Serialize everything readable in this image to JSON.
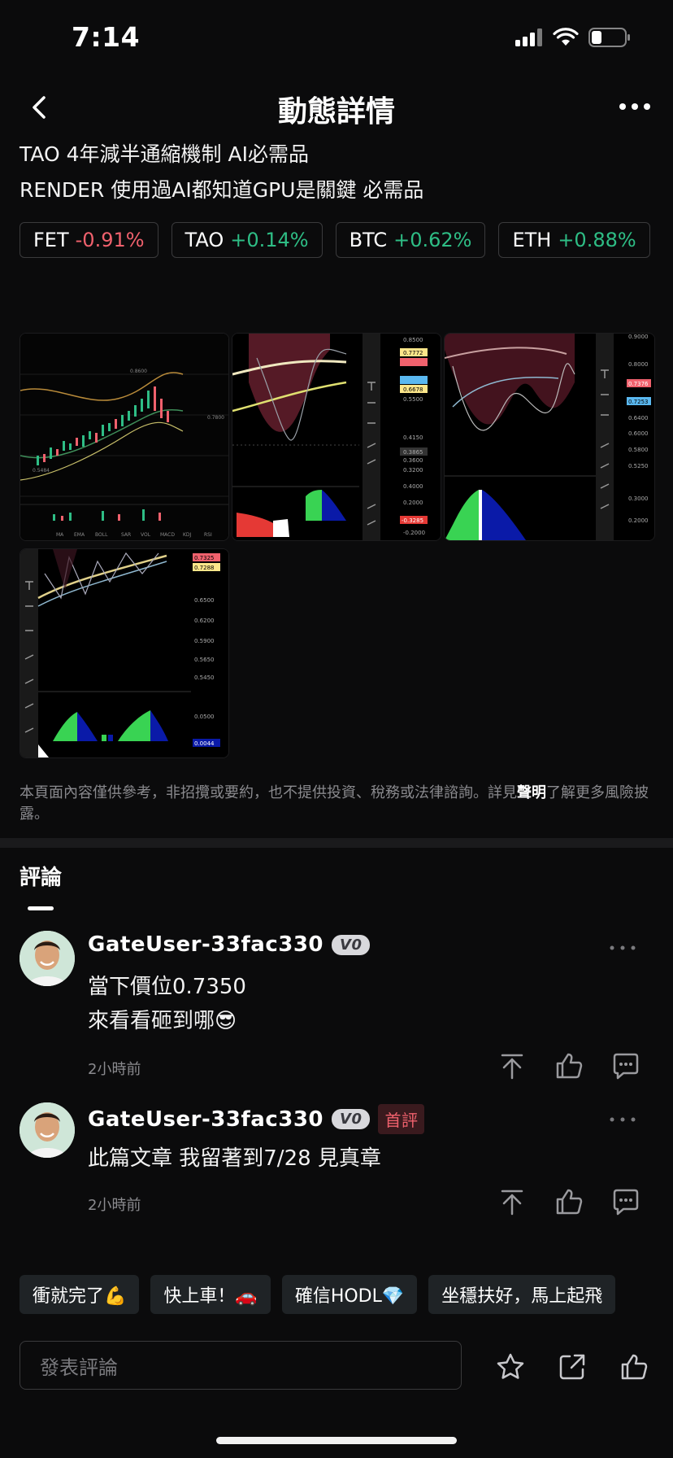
{
  "status_bar": {
    "time": "7:14"
  },
  "header": {
    "title": "動態詳情"
  },
  "post": {
    "lines": [
      "TAO 4年減半通縮機制 AI必需品",
      "RENDER 使用過AI都知道GPU是關鍵 必需品"
    ],
    "tags": [
      {
        "symbol": "FET",
        "change": "-0.91%",
        "direction": "down"
      },
      {
        "symbol": "TAO",
        "change": "+0.14%",
        "direction": "up"
      },
      {
        "symbol": "BTC",
        "change": "+0.62%",
        "direction": "up"
      },
      {
        "symbol": "ETH",
        "change": "+0.88%",
        "direction": "up"
      }
    ],
    "images": [
      {
        "labels": [
          "0.8600",
          "0.7800",
          "0.5484",
          "MA",
          "EMA",
          "BOLL",
          "SAR",
          "VOL",
          "MACD",
          "KDJ",
          "RSI"
        ]
      },
      {
        "labels": [
          "0.8500",
          "0.7772",
          "0.6678",
          "0.5500",
          "0.4150",
          "0.3865",
          "0.3600",
          "0.3200",
          "0.4000",
          "0.2000",
          "-0.3285",
          "-0.2000"
        ]
      },
      {
        "labels": [
          "0.9000",
          "0.8000",
          "0.7376",
          "0.7253",
          "0.6400",
          "0.6000",
          "0.5800",
          "0.5250",
          "0.3000",
          "0.2000"
        ]
      },
      {
        "labels": [
          "0.7325",
          "0.7288",
          "0.6500",
          "0.6200",
          "0.5900",
          "0.5650",
          "0.5450",
          "0.0500",
          "0.0044"
        ]
      }
    ],
    "disclaimer_prefix": "本頁面內容僅供參考，非招攬或要約，也不提供投資、稅務或法律諮詢。詳見",
    "disclaimer_link": "聲明",
    "disclaimer_suffix": "了解更多風險披露。"
  },
  "comments": {
    "heading": "評論",
    "items": [
      {
        "user": "GateUser-33fac330",
        "level": "V0",
        "badge": "",
        "lines": [
          "當下價位0.7350",
          "來看看砸到哪😎"
        ],
        "time": "2小時前"
      },
      {
        "user": "GateUser-33fac330",
        "level": "V0",
        "badge": "首評",
        "lines": [
          "此篇文章 我留著到7/28 見真章"
        ],
        "time": "2小時前"
      }
    ]
  },
  "quick_replies": [
    "衝就完了💪",
    "快上車！🚗",
    "確信HODL💎",
    "坐穩扶好，馬上起飛"
  ],
  "composer": {
    "placeholder": "發表評論"
  },
  "colors": {
    "up": "#2ebd85",
    "down": "#f0616d",
    "background": "#0b0b0c"
  }
}
